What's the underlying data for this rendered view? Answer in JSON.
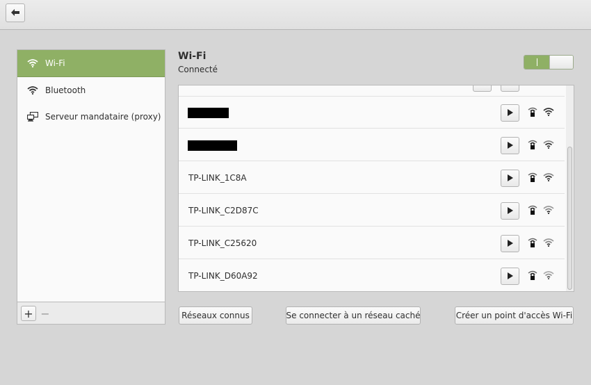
{
  "header": {
    "back_icon": "arrow-left-icon"
  },
  "sidebar": {
    "items": [
      {
        "label": "Wi-Fi",
        "icon": "wifi-icon",
        "selected": true
      },
      {
        "label": "Bluetooth",
        "icon": "wifi-icon",
        "selected": false
      },
      {
        "label": "Serveur mandataire (proxy)",
        "icon": "network-proxy-icon",
        "selected": false
      }
    ],
    "toolbar": {
      "add_label": "+",
      "remove_label": "−"
    }
  },
  "main": {
    "title": "Wi-Fi",
    "status": "Connecté",
    "toggle": {
      "on": true,
      "on_glyph": "|"
    },
    "networks": [
      {
        "name": "",
        "redacted": true,
        "secured": true
      },
      {
        "name": "",
        "redacted": true,
        "secured": true
      },
      {
        "name": "TP-LINK_1C8A",
        "redacted": false,
        "secured": true
      },
      {
        "name": "TP-LINK_C2D87C",
        "redacted": false,
        "secured": true
      },
      {
        "name": "TP-LINK_C25620",
        "redacted": false,
        "secured": true
      },
      {
        "name": "TP-LINK_D60A92",
        "redacted": false,
        "secured": true
      }
    ],
    "buttons": {
      "known": "Réseaux connus",
      "hidden": "Se connecter à un réseau caché",
      "hotspot": "Créer un point d'accès Wi-Fi"
    }
  },
  "colors": {
    "accent": "#8fb065",
    "background": "#d6d6d6"
  }
}
